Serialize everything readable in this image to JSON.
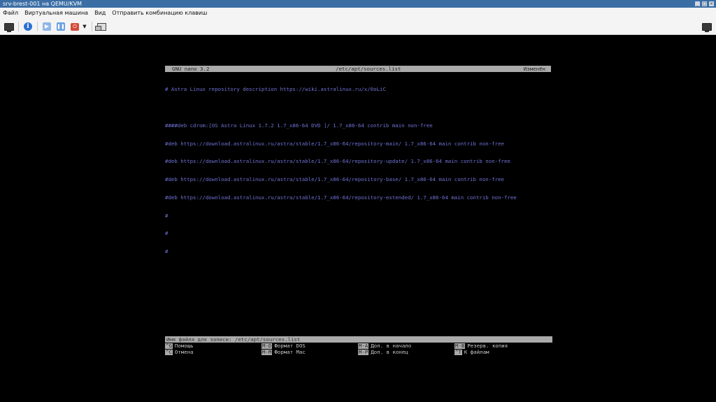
{
  "window": {
    "title": "srv-brest-001 на QEMU/KVM",
    "controls": [
      "_",
      "□",
      "×"
    ]
  },
  "menu": {
    "items": [
      "Файл",
      "Виртуальная машина",
      "Вид",
      "Отправить комбинацию клавиш"
    ]
  },
  "toolbar": {
    "buttons": [
      {
        "name": "console-icon"
      },
      {
        "name": "info-icon"
      },
      {
        "name": "run-icon"
      },
      {
        "name": "pause-icon"
      },
      {
        "name": "shutdown-icon"
      },
      {
        "name": "dropdown-icon"
      },
      {
        "name": "screenshot-icon"
      },
      {
        "name": "fullscreen-icon"
      }
    ]
  },
  "nano": {
    "version": "GNU nano 3.2",
    "filename": "/etc/apt/sources.list",
    "modified": "Изменён",
    "lines": [
      "# Astra Linux repository description https://wiki.astralinux.ru/x/0oLiC",
      "",
      "####deb cdrom:[OS Astra Linux 1.7.2 1.7_x86-64 DVD ]/ 1.7_x86-64 contrib main non-free",
      "#deb https://download.astralinux.ru/astra/stable/1.7_x86-64/repository-main/ 1.7_x86-64 main contrib non-free",
      "#deb https://download.astralinux.ru/astra/stable/1.7_x86-64/repository-update/ 1.7_x86-64 main contrib non-free",
      "#deb https://download.astralinux.ru/astra/stable/1.7_x86-64/repository-base/ 1.7_x86-64 main contrib non-free",
      "#deb https://download.astralinux.ru/astra/stable/1.7_x86-64/repository-extended/ 1.7_x86-64 main contrib non-free",
      "#",
      "#",
      "#"
    ],
    "prompt": "Имя файла для записи: /etc/apt/sources.list",
    "shortcuts": [
      {
        "key": "^G",
        "label": "Помощь"
      },
      {
        "key": "M-D",
        "label": "Формат DOS"
      },
      {
        "key": "M-A",
        "label": "Доп. в начало"
      },
      {
        "key": "M-B",
        "label": "Резерв. копия"
      },
      {
        "key": "^C",
        "label": "Отмена"
      },
      {
        "key": "M-M",
        "label": "Формат Mac"
      },
      {
        "key": "M-P",
        "label": "Доп. в конец"
      },
      {
        "key": "^T",
        "label": "К файлам"
      }
    ]
  }
}
